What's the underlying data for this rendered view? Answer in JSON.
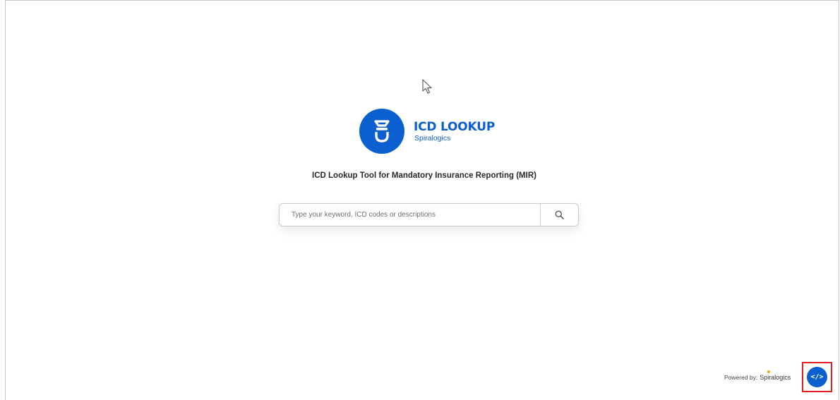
{
  "logo": {
    "title": "ICD LOOKUP",
    "subtitle": "Spiralogics",
    "icon": "stethoscope-bell-icon"
  },
  "tagline": "ICD Lookup Tool for Mandatory Insurance Reporting (MIR)",
  "search": {
    "placeholder": "Type your keyword, ICD codes or descriptions",
    "value": "",
    "button_icon": "search-icon"
  },
  "footer": {
    "powered_label": "Powered by:",
    "powered_brand": "Spiralogics",
    "embed_icon": "code-icon",
    "embed_label": "</>"
  },
  "colors": {
    "brand_blue": "#0b5fcf",
    "highlight_red": "#e02020"
  }
}
